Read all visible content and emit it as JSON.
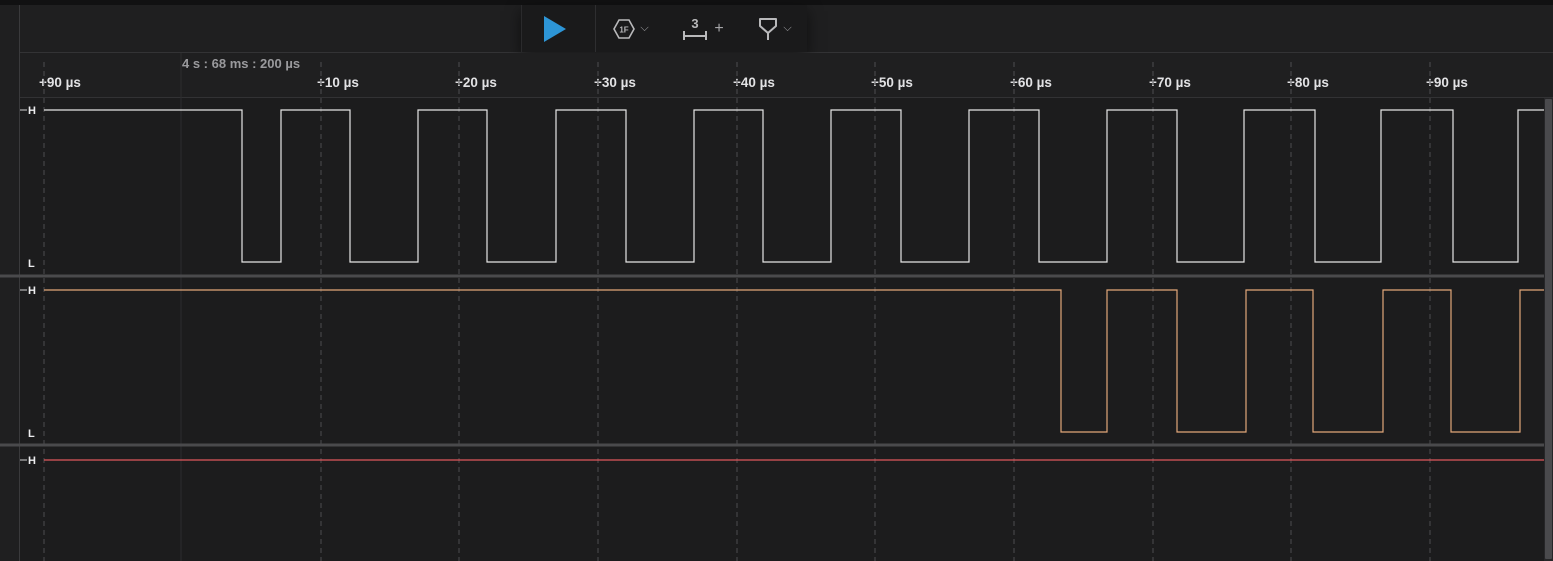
{
  "toolbar": {
    "play_icon": "play-icon",
    "trigger_icon": "trigger-hexagon-icon",
    "trigger_glyph": "1F",
    "measure_icon": "measure-ruler-icon",
    "measure_count": "3",
    "measure_plus": "+",
    "marker_icon": "marker-flag-icon",
    "chevron": "⌵",
    "accent_color": "#2d95d6"
  },
  "timeline": {
    "origin_label": "4 s : 68 ms : 200 µs",
    "tick_labels": [
      "+90 µs",
      "+10 µs",
      "+20 µs",
      "+30 µs",
      "+40 µs",
      "+50 µs",
      "+60 µs",
      "+70 µs",
      "+80 µs",
      "+90 µs"
    ]
  },
  "channels": [
    {
      "high_label": "H",
      "low_label": "L",
      "color": "#e6e6e6"
    },
    {
      "high_label": "H",
      "low_label": "L",
      "color": "#e2a77a"
    },
    {
      "high_label": "H",
      "color": "#e0575b"
    }
  ]
}
